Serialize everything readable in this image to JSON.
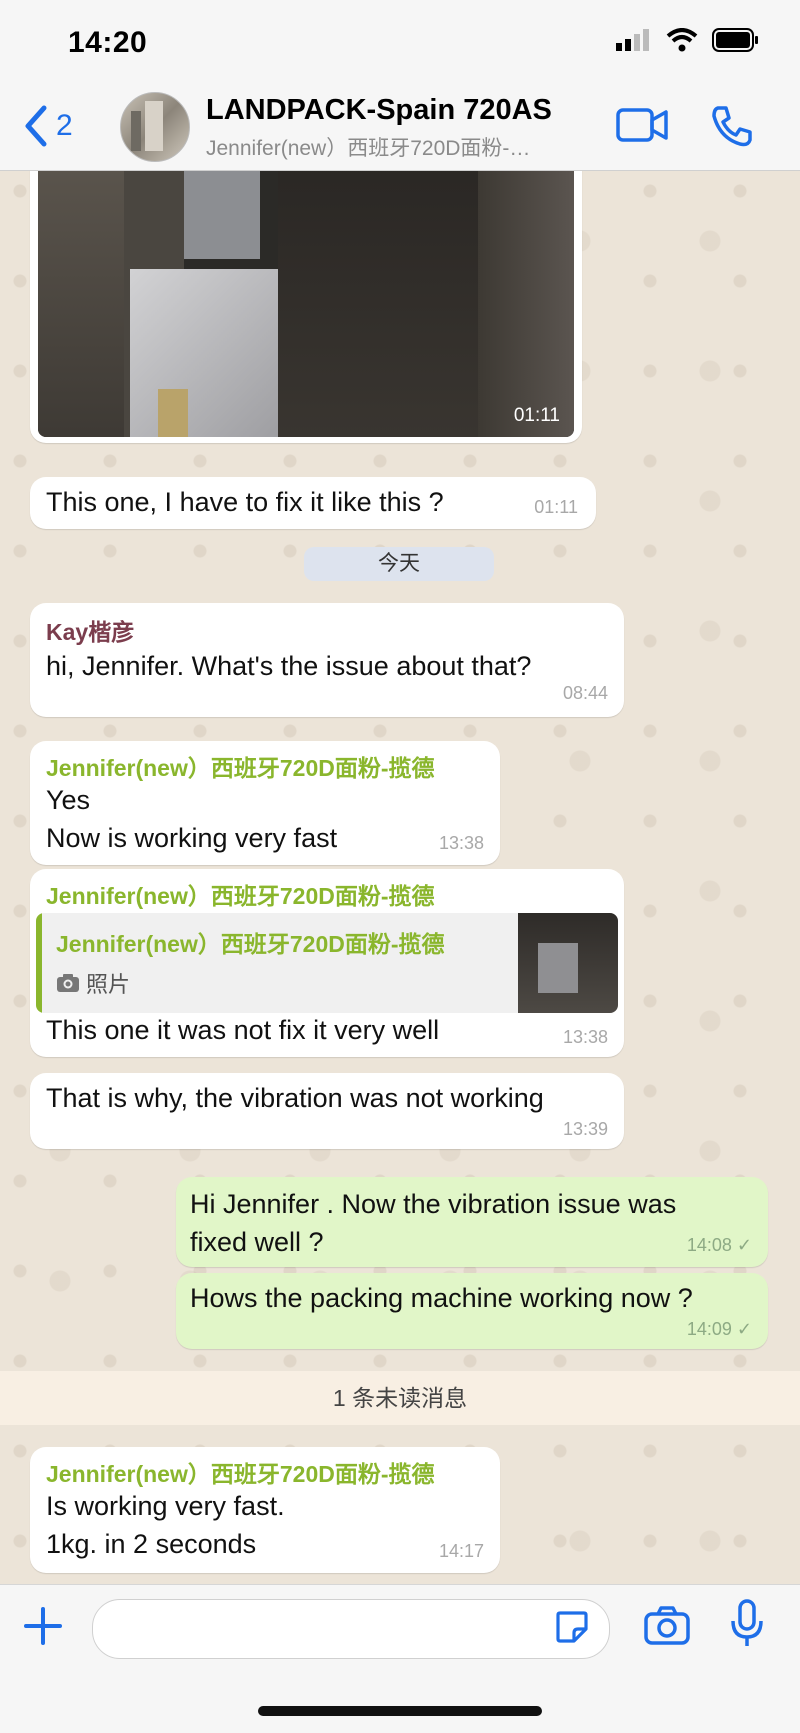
{
  "status_bar": {
    "time": "14:20"
  },
  "header": {
    "back_count": "2",
    "title": "LANDPACK-Spain 720AS",
    "subtitle": "Jennifer(new）西班牙720D面粉-…"
  },
  "messages": {
    "video": {
      "duration": "01:11"
    },
    "m1": {
      "text": "This one, I have to fix it like this ?",
      "time": "01:11"
    },
    "date_divider": "今天",
    "m2": {
      "sender": "Kay楷彦",
      "text": "hi, Jennifer. What's the issue about that?",
      "time": "08:44"
    },
    "m3": {
      "sender": "Jennifer(new）西班牙720D面粉-揽德",
      "line1": "Yes",
      "line2": "Now is working very fast",
      "time": "13:38"
    },
    "m4": {
      "sender": "Jennifer(new）西班牙720D面粉-揽德",
      "quote_sender": "Jennifer(new）西班牙720D面粉-揽德",
      "quote_label": "照片",
      "text": "This one it was not fix it very well",
      "time": "13:38"
    },
    "m5": {
      "text": "That is why, the vibration was not working",
      "time": "13:39"
    },
    "m6": {
      "line1": "Hi Jennifer . Now the vibration issue was",
      "line2": "fixed well ?",
      "time": "14:08"
    },
    "m7": {
      "text": "Hows the packing machine working now ?",
      "time": "14:09"
    },
    "unread_divider": "1 条未读消息",
    "m8": {
      "sender": "Jennifer(new）西班牙720D面粉-揽德",
      "line1": "Is working very fast.",
      "line2": "1kg. in 2 seconds",
      "time": "14:17"
    }
  },
  "input": {
    "placeholder": ""
  },
  "colors": {
    "accent": "#1e6ee8",
    "outgoing": "#e1f6c8",
    "sender_green": "#8ab62d",
    "sender_kay": "#7b3d4d"
  },
  "icons": [
    "signal-icon",
    "wifi-icon",
    "battery-icon",
    "back-chevron-icon",
    "video-call-icon",
    "phone-icon",
    "plus-icon",
    "sticker-icon",
    "camera-icon",
    "mic-icon",
    "read-check-icon"
  ]
}
